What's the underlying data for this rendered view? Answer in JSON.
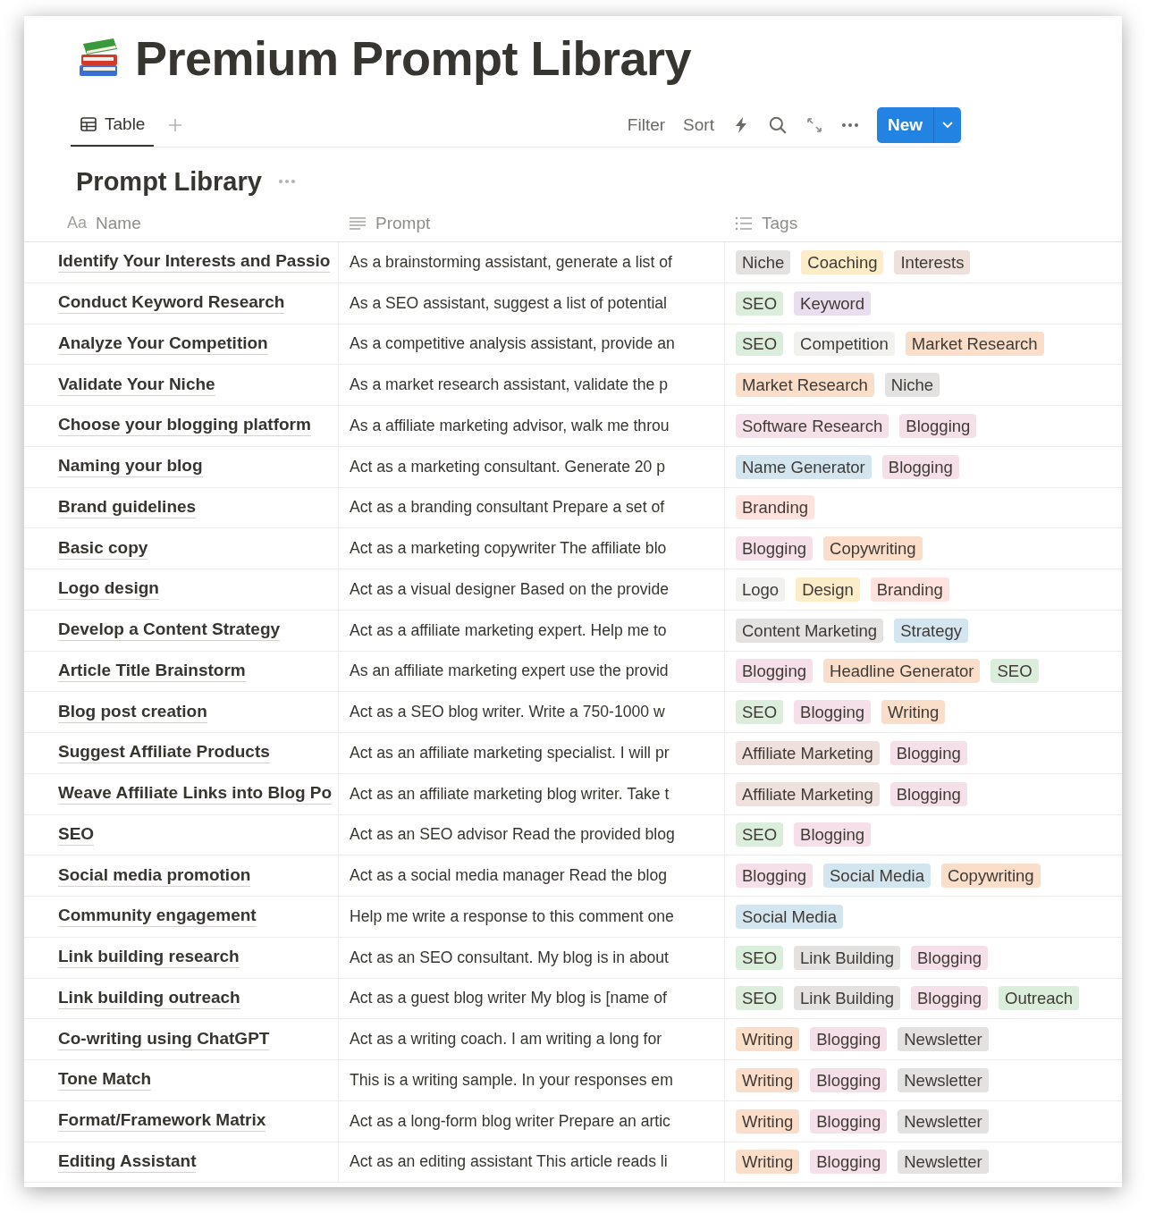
{
  "page": {
    "title": "Premium Prompt Library"
  },
  "views": [
    {
      "label": "Table",
      "selected": true
    }
  ],
  "toolbar": {
    "filter": "Filter",
    "sort": "Sort",
    "new_button": "New"
  },
  "database": {
    "title": "Prompt Library",
    "columns": [
      {
        "label": "Name",
        "kind": "title",
        "icon_text": "Aa"
      },
      {
        "label": "Prompt",
        "kind": "text"
      },
      {
        "label": "Tags",
        "kind": "multi_select"
      }
    ],
    "rows": [
      {
        "name": "Identify Your Interests and Passio",
        "prompt": "As a brainstorming assistant, generate a list of",
        "tags": [
          {
            "label": "Niche",
            "color": "#e3e2e0"
          },
          {
            "label": "Coaching",
            "color": "#fdecc8"
          },
          {
            "label": "Interests",
            "color": "#eee0da"
          }
        ]
      },
      {
        "name": "Conduct Keyword Research",
        "prompt": "As a SEO assistant, suggest a list of potential",
        "tags": [
          {
            "label": "SEO",
            "color": "#dbeddb"
          },
          {
            "label": "Keyword",
            "color": "#e8deee"
          }
        ]
      },
      {
        "name": "Analyze Your Competition",
        "prompt": "As a competitive analysis assistant, provide an",
        "tags": [
          {
            "label": "SEO",
            "color": "#dbeddb"
          },
          {
            "label": "Competition",
            "color": "#f1f1ef"
          },
          {
            "label": "Market Research",
            "color": "#fadec9"
          }
        ]
      },
      {
        "name": "Validate Your Niche",
        "prompt": "As a market research assistant, validate the p",
        "tags": [
          {
            "label": "Market Research",
            "color": "#fadec9"
          },
          {
            "label": "Niche",
            "color": "#e3e2e0"
          }
        ]
      },
      {
        "name": "Choose your blogging platform",
        "prompt": "As a affiliate marketing advisor, walk me throu",
        "tags": [
          {
            "label": "Software Research",
            "color": "#f5e0e9"
          },
          {
            "label": "Blogging",
            "color": "#f5e0e9"
          }
        ]
      },
      {
        "name": "Naming your blog",
        "prompt": "Act as a marketing consultant. Generate 20 p",
        "tags": [
          {
            "label": "Name Generator",
            "color": "#d3e5ef"
          },
          {
            "label": "Blogging",
            "color": "#f5e0e9"
          }
        ]
      },
      {
        "name": "Brand guidelines",
        "prompt": "Act as a branding consultant Prepare a set of",
        "tags": [
          {
            "label": "Branding",
            "color": "#ffe2dd"
          }
        ]
      },
      {
        "name": "Basic copy",
        "prompt": "Act as a marketing copywriter The affiliate blo",
        "tags": [
          {
            "label": "Blogging",
            "color": "#f5e0e9"
          },
          {
            "label": "Copywriting",
            "color": "#fadec9"
          }
        ]
      },
      {
        "name": "Logo design",
        "prompt": "Act as a visual designer Based on the provide",
        "tags": [
          {
            "label": "Logo",
            "color": "#f1f1ef"
          },
          {
            "label": "Design",
            "color": "#fdecc8"
          },
          {
            "label": "Branding",
            "color": "#ffe2dd"
          }
        ]
      },
      {
        "name": "Develop a Content Strategy",
        "prompt": "Act as a affiliate marketing expert. Help me to",
        "tags": [
          {
            "label": "Content Marketing",
            "color": "#e3e2e0"
          },
          {
            "label": "Strategy",
            "color": "#d3e5ef"
          }
        ]
      },
      {
        "name": "Article Title Brainstorm",
        "prompt": "As an affiliate marketing expert use the provid",
        "tags": [
          {
            "label": "Blogging",
            "color": "#f5e0e9"
          },
          {
            "label": "Headline Generator",
            "color": "#fadec9"
          },
          {
            "label": "SEO",
            "color": "#dbeddb"
          }
        ]
      },
      {
        "name": "Blog post creation",
        "prompt": "Act as a SEO blog writer. Write a 750-1000 w",
        "tags": [
          {
            "label": "SEO",
            "color": "#dbeddb"
          },
          {
            "label": "Blogging",
            "color": "#f5e0e9"
          },
          {
            "label": "Writing",
            "color": "#fadec9"
          }
        ]
      },
      {
        "name": "Suggest Affiliate Products",
        "prompt": "Act as an affiliate marketing specialist. I will pr",
        "tags": [
          {
            "label": "Affiliate Marketing",
            "color": "#eee0da"
          },
          {
            "label": "Blogging",
            "color": "#f5e0e9"
          }
        ]
      },
      {
        "name": "Weave Affiliate Links into Blog Po",
        "prompt": "Act as an affiliate marketing blog writer. Take t",
        "tags": [
          {
            "label": "Affiliate Marketing",
            "color": "#eee0da"
          },
          {
            "label": "Blogging",
            "color": "#f5e0e9"
          }
        ]
      },
      {
        "name": "SEO",
        "prompt": "Act as an SEO advisor Read the provided blog",
        "tags": [
          {
            "label": "SEO",
            "color": "#dbeddb"
          },
          {
            "label": "Blogging",
            "color": "#f5e0e9"
          }
        ]
      },
      {
        "name": "Social media promotion",
        "prompt": "Act as a social media manager Read the blog",
        "tags": [
          {
            "label": "Blogging",
            "color": "#f5e0e9"
          },
          {
            "label": "Social Media",
            "color": "#d3e5ef"
          },
          {
            "label": "Copywriting",
            "color": "#fadec9"
          }
        ]
      },
      {
        "name": "Community engagement",
        "prompt": "Help me write a response to this comment one",
        "tags": [
          {
            "label": "Social Media",
            "color": "#d3e5ef"
          }
        ]
      },
      {
        "name": "Link building research",
        "prompt": "Act as an SEO consultant. My blog is in about",
        "tags": [
          {
            "label": "SEO",
            "color": "#dbeddb"
          },
          {
            "label": "Link Building",
            "color": "#e3e2e0"
          },
          {
            "label": "Blogging",
            "color": "#f5e0e9"
          }
        ]
      },
      {
        "name": "Link building outreach",
        "prompt": "Act as a guest blog writer My blog is [name of",
        "tags": [
          {
            "label": "SEO",
            "color": "#dbeddb"
          },
          {
            "label": "Link Building",
            "color": "#e3e2e0"
          },
          {
            "label": "Blogging",
            "color": "#f5e0e9"
          },
          {
            "label": "Outreach",
            "color": "#dbeddb"
          }
        ]
      },
      {
        "name": "Co-writing using ChatGPT",
        "prompt": "Act as a writing coach. I am writing a long for",
        "tags": [
          {
            "label": "Writing",
            "color": "#fadec9"
          },
          {
            "label": "Blogging",
            "color": "#f5e0e9"
          },
          {
            "label": "Newsletter",
            "color": "#e3e2e0"
          }
        ]
      },
      {
        "name": "Tone Match",
        "prompt": "This is a writing sample. In your responses em",
        "tags": [
          {
            "label": "Writing",
            "color": "#fadec9"
          },
          {
            "label": "Blogging",
            "color": "#f5e0e9"
          },
          {
            "label": "Newsletter",
            "color": "#e3e2e0"
          }
        ]
      },
      {
        "name": "Format/Framework Matrix",
        "prompt": "Act as a long-form blog writer Prepare an artic",
        "tags": [
          {
            "label": "Writing",
            "color": "#fadec9"
          },
          {
            "label": "Blogging",
            "color": "#f5e0e9"
          },
          {
            "label": "Newsletter",
            "color": "#e3e2e0"
          }
        ]
      },
      {
        "name": "Editing Assistant",
        "prompt": "Act as an editing assistant This article reads li",
        "tags": [
          {
            "label": "Writing",
            "color": "#fadec9"
          },
          {
            "label": "Blogging",
            "color": "#f5e0e9"
          },
          {
            "label": "Newsletter",
            "color": "#e3e2e0"
          }
        ]
      }
    ]
  }
}
